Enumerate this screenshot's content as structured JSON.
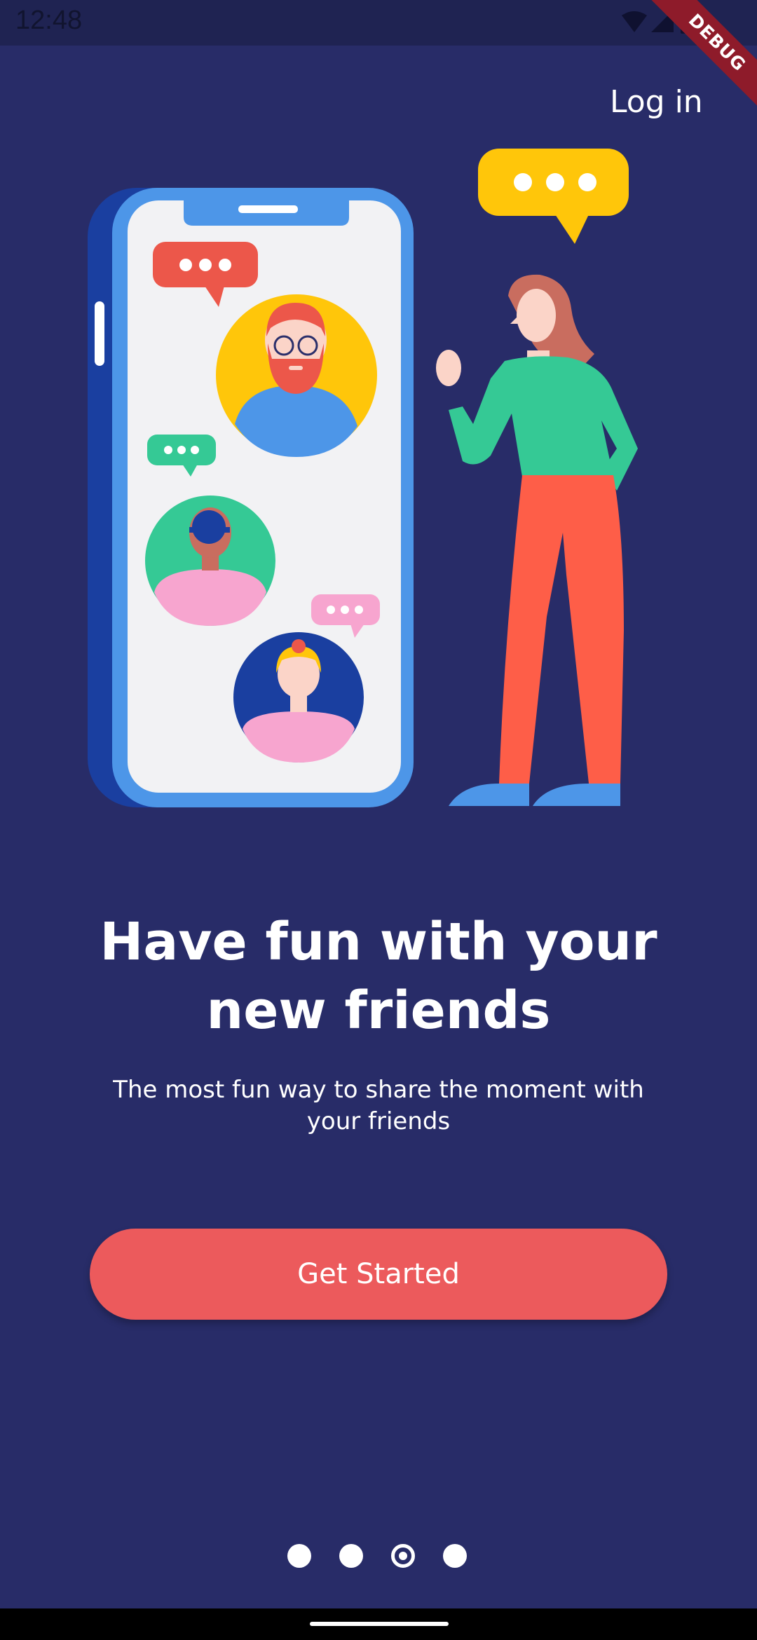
{
  "status_bar": {
    "time": "12:48",
    "icons": [
      "wifi-icon",
      "cell-signal-icon",
      "battery-icon"
    ]
  },
  "debug_banner": "DEBUG",
  "header": {
    "login_label": "Log in"
  },
  "onboarding": {
    "title": "Have fun with your new friends",
    "subtitle": "The most fun way to share the moment with your friends",
    "cta_label": "Get Started"
  },
  "pager": {
    "total": 4,
    "active_index": 2
  },
  "colors": {
    "background": "#282c68",
    "accent": "#ec5a5c",
    "phone_blue": "#4d96e8",
    "yellow": "#ffc60a",
    "green": "#35c995",
    "orange": "#fe5e48",
    "pink": "#f7a5cf"
  }
}
